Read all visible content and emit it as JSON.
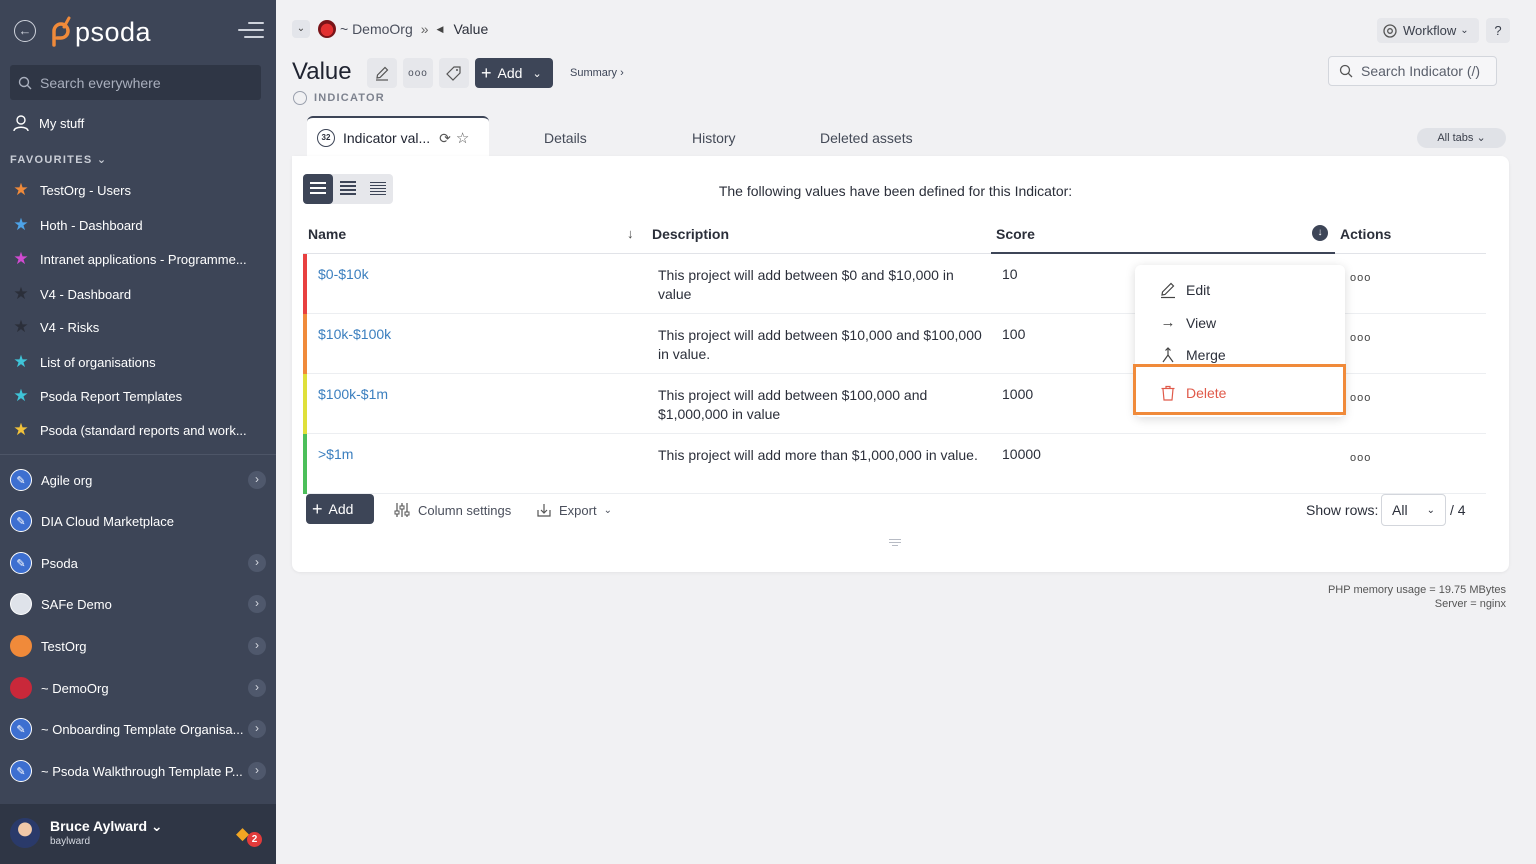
{
  "sidebar": {
    "search_placeholder": "Search everywhere",
    "my_stuff": "My stuff",
    "favourites_heading": "FAVOURITES",
    "favourites": [
      {
        "label": "TestOrg - Users",
        "star_color": "#f08a3a"
      },
      {
        "label": "Hoth - Dashboard",
        "star_color": "#4da3e8"
      },
      {
        "label": "Intranet applications - Programme...",
        "star_color": "#d14ad1"
      },
      {
        "label": "V4 - Dashboard",
        "star_color": "#2b2f3a"
      },
      {
        "label": "V4 - Risks",
        "star_color": "#2b2f3a"
      },
      {
        "label": "List of organisations",
        "star_color": "#3fc4d8"
      },
      {
        "label": "Psoda Report Templates",
        "star_color": "#3fc4d8"
      },
      {
        "label": "Psoda (standard reports and work...",
        "star_color": "#f2c23a"
      }
    ],
    "orgs": [
      {
        "label": "Agile org"
      },
      {
        "label": "DIA Cloud Marketplace"
      },
      {
        "label": "Psoda"
      },
      {
        "label": "SAFe Demo"
      },
      {
        "label": "TestOrg"
      },
      {
        "label": "~ DemoOrg"
      },
      {
        "label": "~ Onboarding Template Organisa..."
      },
      {
        "label": "~ Psoda Walkthrough Template P..."
      }
    ],
    "user": {
      "name": "Bruce Aylward",
      "login": "baylward",
      "notifications": "2"
    }
  },
  "header": {
    "breadcrumb_org": "~ DemoOrg",
    "breadcrumb_sep": "»",
    "breadcrumb_current": "Value",
    "workflow_label": "Workflow",
    "help_label": "?",
    "page_title": "Value",
    "add_label": "Add",
    "summary_link": "Summary ›",
    "type_label": "INDICATOR",
    "search_placeholder": "Search Indicator (/)"
  },
  "tabs": {
    "active_label": "Indicator val...",
    "active_count": "32",
    "details": "Details",
    "history": "History",
    "deleted_assets": "Deleted assets",
    "all_tabs": "All tabs"
  },
  "table": {
    "intro": "The following values have been defined for this Indicator:",
    "columns": {
      "name": "Name",
      "description": "Description",
      "score": "Score",
      "actions": "Actions"
    },
    "rows": [
      {
        "name": "$0-$10k",
        "description": "This project will add between $0 and $10,000 in value",
        "score": "10",
        "color": "#e84040"
      },
      {
        "name": "$10k-$100k",
        "description": "This project will add between $10,000 and $100,000 in value.",
        "score": "100",
        "color": "#f08a3a"
      },
      {
        "name": "$100k-$1m",
        "description": "This project will add between $100,000 and $1,000,000 in value",
        "score": "1000",
        "color": "#dfe03a"
      },
      {
        "name": ">$1m",
        "description": "This project will add more than $1,000,000 in value.",
        "score": "10000",
        "color": "#4cbf5a"
      }
    ],
    "actions_glyph": "ooo",
    "add_label": "Add",
    "column_settings": "Column settings",
    "export": "Export",
    "show_rows_label": "Show rows:",
    "show_rows_value": "All",
    "rows_total": "/ 4"
  },
  "menu": {
    "edit": "Edit",
    "view": "View",
    "merge": "Merge",
    "delete": "Delete",
    "delete_color": "#e05a4a",
    "highlight_color": "#f08a3a"
  },
  "footer": {
    "memory": "PHP memory usage = 19.75 MBytes",
    "server": "Server = nginx"
  }
}
